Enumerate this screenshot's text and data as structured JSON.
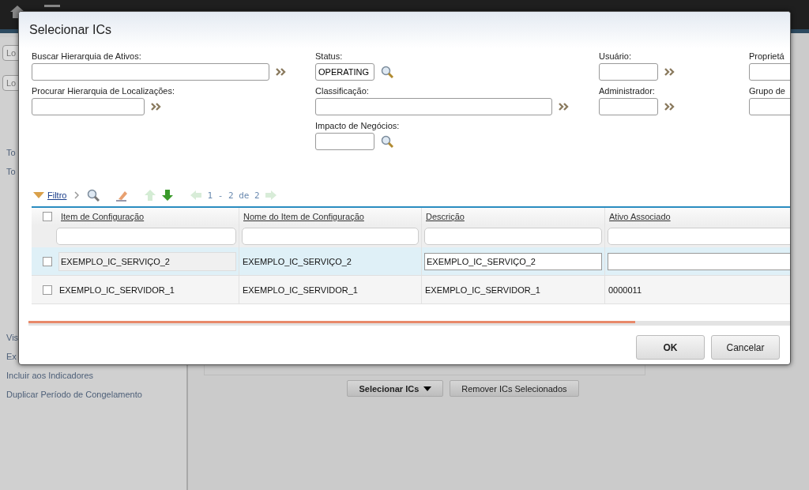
{
  "background": {
    "search_fields": [
      {
        "placeholder": "Lo"
      },
      {
        "placeholder": "Lo"
      }
    ],
    "sidebar": {
      "items_top": [
        "To",
        "To"
      ],
      "items_bottom": [
        "Vis",
        "Ex",
        "Incluir aos Indicadores",
        "Duplicar Período de Congelamento"
      ]
    },
    "buttons": [
      {
        "label": "Selecionar ICs",
        "kind": "menu"
      },
      {
        "label": "Remover ICs Selecionados",
        "kind": "plain"
      }
    ]
  },
  "dialog": {
    "title": "Selecionar ICs",
    "filter_columns": [
      [
        {
          "label": "Buscar Hierarquia de Ativos:",
          "kind": "chevron"
        },
        {
          "label": "Procurar Hierarquia de Localizações:",
          "kind": "chevron"
        }
      ],
      [
        {
          "label": "Status:",
          "value": "OPERATING",
          "kind": "search"
        },
        {
          "label": "Classificação:",
          "kind": "chevron"
        },
        {
          "label": "Impacto de Negócios:",
          "kind": "search"
        }
      ],
      [
        {
          "label": "Usuário:",
          "kind": "chevron"
        },
        {
          "label": "Administrador:",
          "kind": "chevron"
        }
      ],
      [
        {
          "label": "Proprietá",
          "kind": "plain"
        },
        {
          "label": "Grupo de",
          "kind": "plain"
        }
      ]
    ],
    "toolbar": {
      "filter_link": "Filtro",
      "pager": "1 - 2 de 2"
    },
    "table": {
      "select_all": {
        "checked": false
      },
      "columns": [
        "Item de Configuração",
        "Nome do Item de Configuração",
        "Descrição",
        "Ativo Associado"
      ],
      "rows": [
        {
          "selected": true,
          "checked": false,
          "editing": true,
          "cells": [
            "EXEMPLO_IC_SERVIÇO_2",
            "EXEMPLO_IC_SERVIÇO_2",
            "EXEMPLO_IC_SERVIÇO_2",
            null
          ]
        },
        {
          "selected": false,
          "checked": false,
          "editing": false,
          "cells": [
            "EXEMPLO_IC_SERVIDOR_1",
            "EXEMPLO_IC_SERVIDOR_1",
            "EXEMPLO_IC_SERVIDOR_1",
            "0000011"
          ]
        }
      ]
    },
    "buttons": [
      "OK",
      "Cancelar"
    ]
  }
}
